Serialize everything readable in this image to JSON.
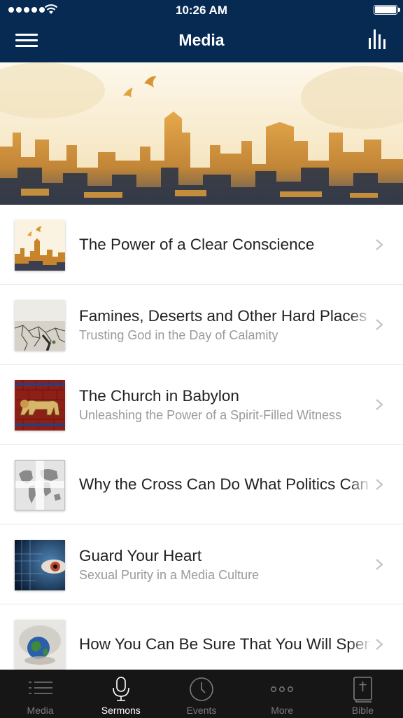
{
  "status": {
    "time": "10:26 AM"
  },
  "nav": {
    "title": "Media"
  },
  "sermons": [
    {
      "title": "The Power of a Clear Conscience",
      "subtitle": ""
    },
    {
      "title": "Famines, Deserts and Other Hard Places",
      "subtitle": "Trusting God in the Day of Calamity"
    },
    {
      "title": "The Church in Babylon",
      "subtitle": "Unleashing the Power of a Spirit-Filled Witness"
    },
    {
      "title": "Why the Cross Can Do What Politics Can't",
      "subtitle": ""
    },
    {
      "title": "Guard Your Heart",
      "subtitle": "Sexual Purity in a Media Culture"
    },
    {
      "title": "How You Can Be Sure That You Will Spend Eternity",
      "subtitle": ""
    }
  ],
  "tabs": [
    {
      "label": "Media",
      "icon": "list-icon",
      "active": false
    },
    {
      "label": "Sermons",
      "icon": "microphone-icon",
      "active": true
    },
    {
      "label": "Events",
      "icon": "clock-icon",
      "active": false
    },
    {
      "label": "More",
      "icon": "more-dots-icon",
      "active": false
    },
    {
      "label": "Bible",
      "icon": "bible-icon",
      "active": false
    }
  ],
  "colors": {
    "navbar": "#062a52",
    "tabbar": "#161616",
    "accent": "#e8a33a"
  }
}
